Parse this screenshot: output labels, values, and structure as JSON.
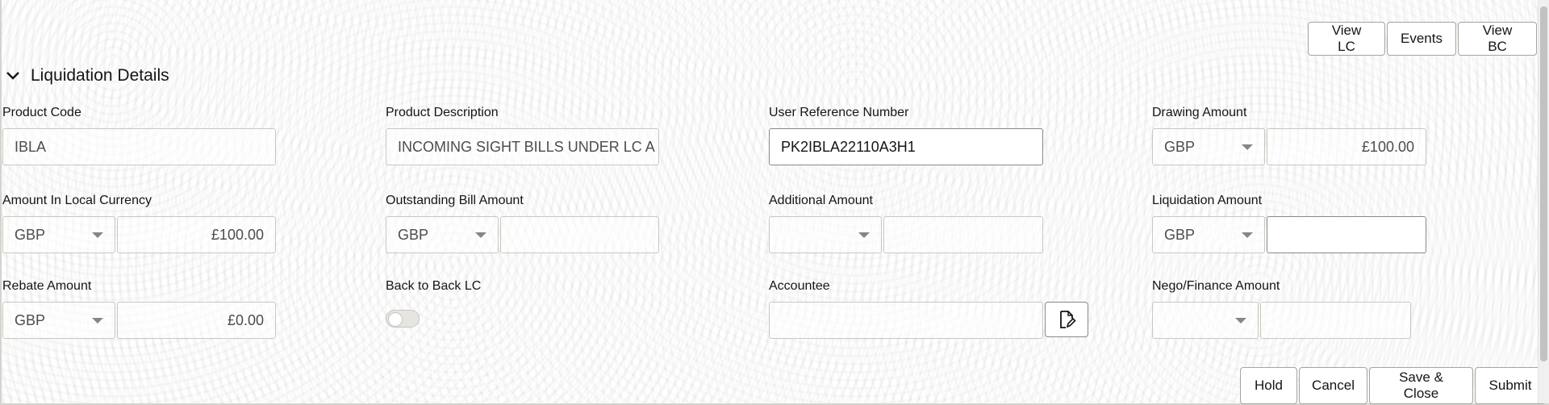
{
  "top_actions": {
    "view_lc": "View LC",
    "events": "Events",
    "view_bc": "View BC"
  },
  "section": {
    "title": "Liquidation Details"
  },
  "fields": {
    "product_code": {
      "label": "Product Code",
      "value": "IBLA"
    },
    "product_description": {
      "label": "Product Description",
      "value": "INCOMING SIGHT BILLS UNDER LC A"
    },
    "user_reference_number": {
      "label": "User Reference Number",
      "value": "PK2IBLA22110A3H1"
    },
    "drawing_amount": {
      "label": "Drawing Amount",
      "currency": "GBP",
      "value": "£100.00"
    },
    "amount_in_local_currency": {
      "label": "Amount In Local Currency",
      "currency": "GBP",
      "value": "£100.00"
    },
    "outstanding_bill_amount": {
      "label": "Outstanding Bill Amount",
      "currency": "GBP",
      "value": ""
    },
    "additional_amount": {
      "label": "Additional Amount",
      "currency": "",
      "value": ""
    },
    "liquidation_amount": {
      "label": "Liquidation Amount",
      "currency": "GBP",
      "value": ""
    },
    "rebate_amount": {
      "label": "Rebate Amount",
      "currency": "GBP",
      "value": "£0.00"
    },
    "back_to_back_lc": {
      "label": "Back to Back LC",
      "checked": false
    },
    "accountee": {
      "label": "Accountee",
      "value": ""
    },
    "nego_finance_amount": {
      "label": "Nego/Finance Amount",
      "currency": "",
      "value": ""
    }
  },
  "bottom_actions": {
    "hold": "Hold",
    "cancel": "Cancel",
    "save_close": "Save & Close",
    "submit": "Submit"
  },
  "icons": {
    "section_toggle": "chevron-down-icon",
    "caret": "caret-down-icon",
    "accountee_lookup": "document-edit-icon"
  },
  "colors": {
    "text": "#161513",
    "border": "#cbc7c2",
    "active_border": "#8d8883"
  }
}
